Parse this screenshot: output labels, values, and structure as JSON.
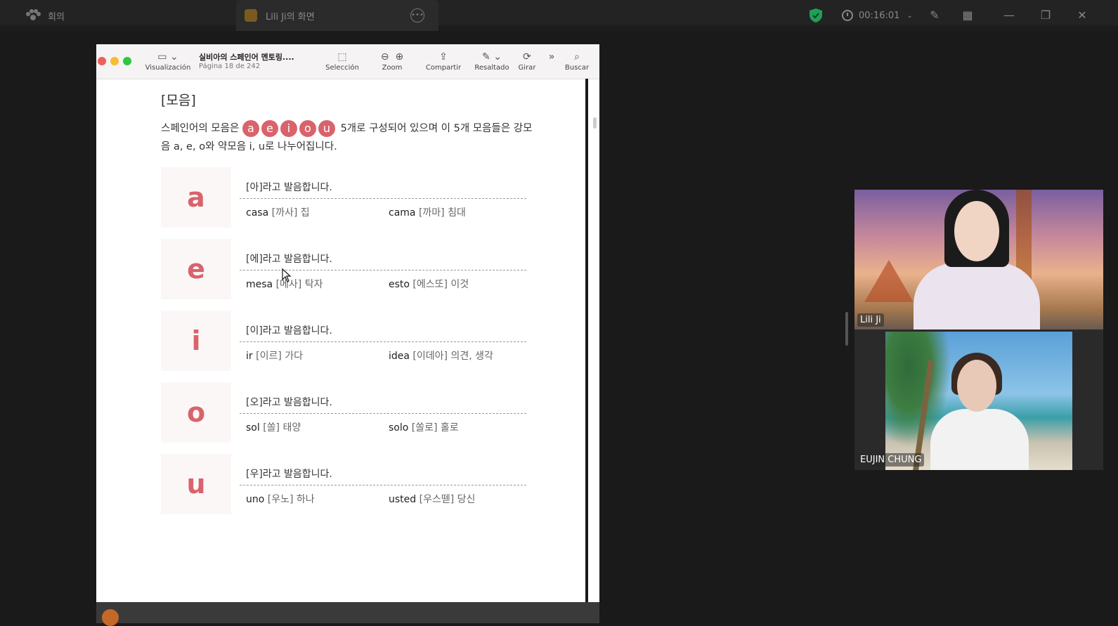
{
  "tabs": {
    "meeting": "회의",
    "screen_share": "Lili Ji의 화면"
  },
  "meeting": {
    "timer": "00:16:01"
  },
  "pdf": {
    "doc_title": "실비아의 스페인어 멘토링....",
    "page_info": "Página 18 de 242",
    "toolbar": {
      "view": "Visualización",
      "selection": "Selección",
      "zoom": "Zoom",
      "share": "Compartir",
      "highlight": "Resaltado",
      "rotate": "Girar",
      "search": "Buscar"
    },
    "heading": "[모음]",
    "intro_prefix": "스페인어의 모음은",
    "intro_vowels": [
      "a",
      "e",
      "i",
      "o",
      "u"
    ],
    "intro_suffix": "5개로 구성되어 있으며 이 5개 모음들은 강모음 a, e, o와 약모음 i, u로 나누어집니다.",
    "vowels": [
      {
        "letter": "a",
        "pron": "[아]라고 발음합니다.",
        "ex1_word": "casa",
        "ex1_k": "[까사] 집",
        "ex2_word": "cama",
        "ex2_k": "[까마] 침대"
      },
      {
        "letter": "e",
        "pron": "[에]라고 발음합니다.",
        "ex1_word": "mesa",
        "ex1_k": "[메사] 탁자",
        "ex2_word": "esto",
        "ex2_k": "[에스또] 이것"
      },
      {
        "letter": "i",
        "pron": "[이]라고 발음합니다.",
        "ex1_word": "ir",
        "ex1_k": "[이르] 가다",
        "ex2_word": "idea",
        "ex2_k": "[이데아] 의견, 생각"
      },
      {
        "letter": "o",
        "pron": "[오]라고 발음합니다.",
        "ex1_word": "sol",
        "ex1_k": "[쏠] 태양",
        "ex2_word": "solo",
        "ex2_k": "[쏠로] 홀로"
      },
      {
        "letter": "u",
        "pron": "[우]라고 발음합니다.",
        "ex1_word": "uno",
        "ex1_k": "[우노] 하나",
        "ex2_word": "usted",
        "ex2_k": "[우스뗃] 당신"
      }
    ]
  },
  "participants": [
    {
      "name": "Lili Ji"
    },
    {
      "name": "EUJIN CHUNG"
    }
  ],
  "colors": {
    "accent_vowel": "#d9636b",
    "shield": "#1f9e5a"
  }
}
